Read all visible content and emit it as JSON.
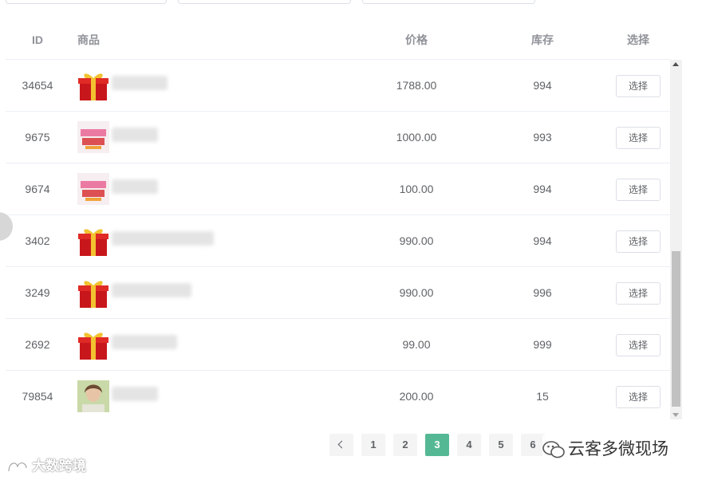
{
  "table": {
    "headers": {
      "id": "ID",
      "goods": "商品",
      "price": "价格",
      "stock": "库存",
      "select": "选择"
    },
    "rows": [
      {
        "id": "34654",
        "image": "gift-box",
        "price": "1788.00",
        "stock": "994",
        "button": "选择"
      },
      {
        "id": "9675",
        "image": "vip-card",
        "price": "1000.00",
        "stock": "993",
        "button": "选择"
      },
      {
        "id": "9674",
        "image": "vip-card",
        "price": "100.00",
        "stock": "994",
        "button": "选择"
      },
      {
        "id": "3402",
        "image": "gift-box",
        "price": "990.00",
        "stock": "994",
        "button": "选择"
      },
      {
        "id": "3249",
        "image": "gift-box",
        "price": "990.00",
        "stock": "996",
        "button": "选择"
      },
      {
        "id": "2692",
        "image": "gift-box",
        "price": "99.00",
        "stock": "999",
        "button": "选择"
      },
      {
        "id": "79854",
        "image": "person-photo",
        "price": "200.00",
        "stock": "15",
        "button": "选择"
      }
    ]
  },
  "pagination": {
    "pages": [
      "1",
      "2",
      "3",
      "4",
      "5",
      "6"
    ],
    "current": "3"
  },
  "watermark": {
    "right": "云客多微现场",
    "left": "大数跨境"
  },
  "colors": {
    "accent": "#55b895"
  }
}
